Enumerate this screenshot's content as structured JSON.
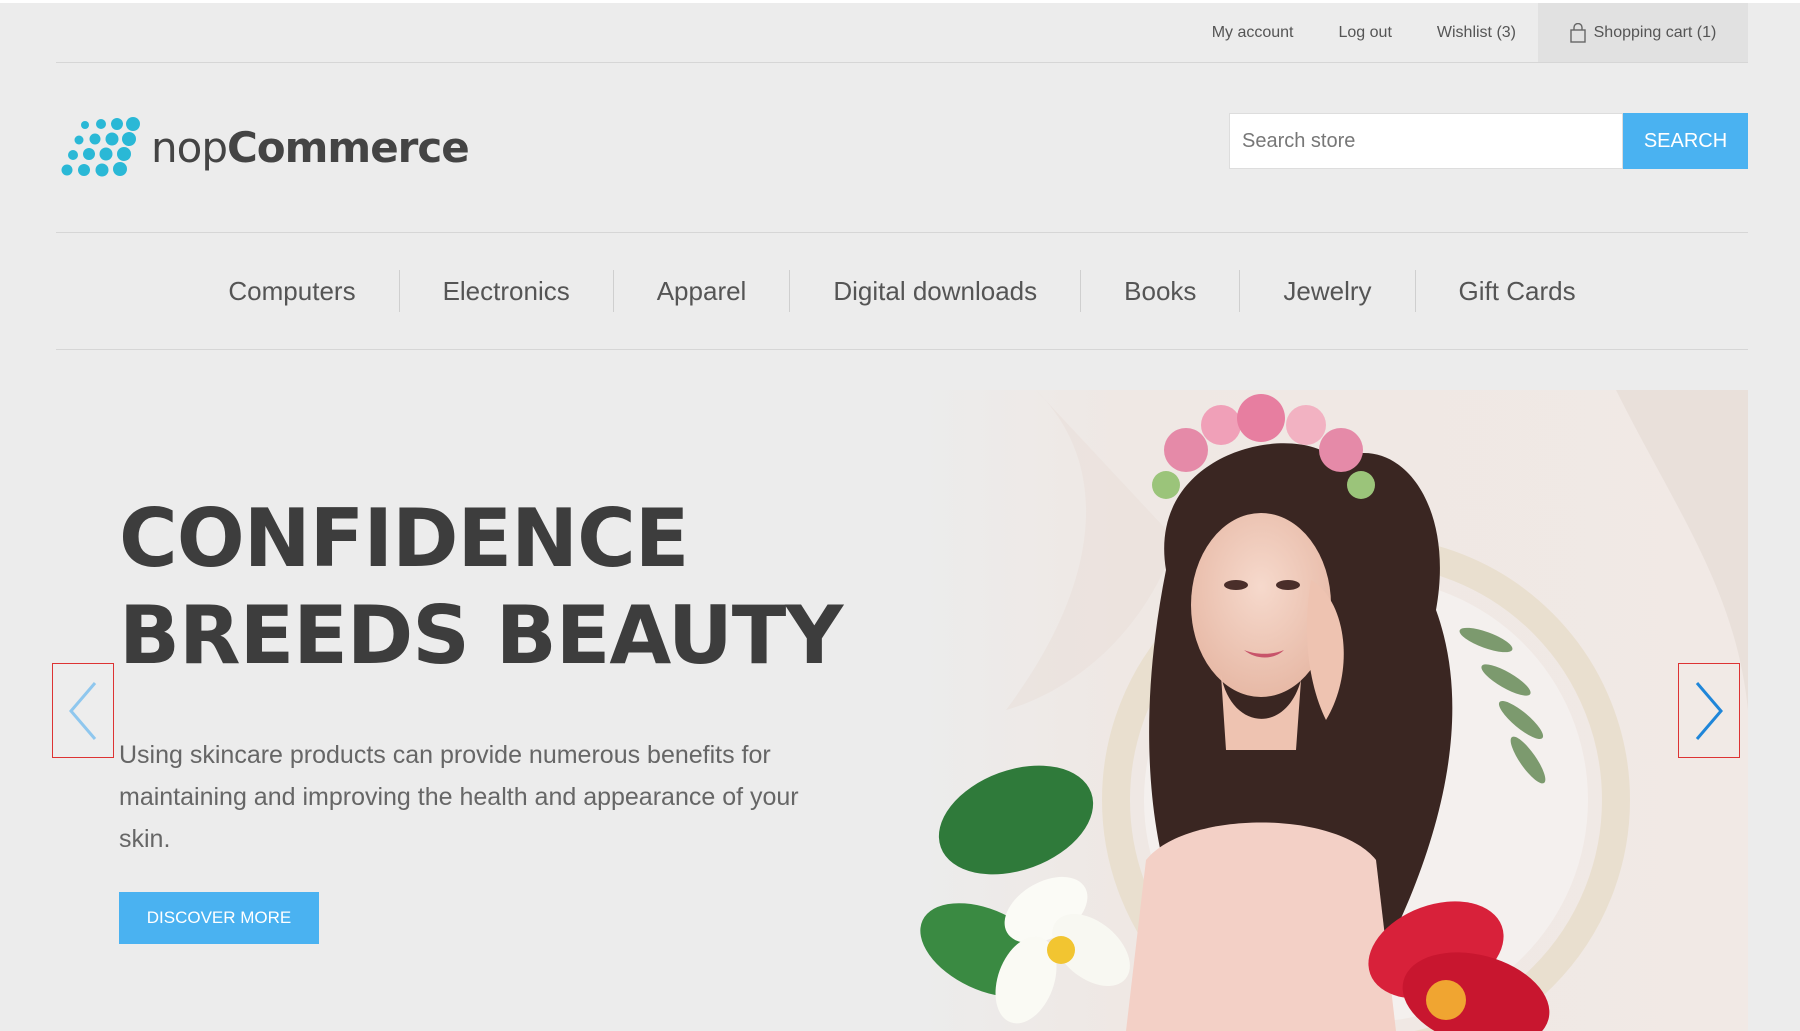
{
  "header": {
    "links": {
      "my_account": "My account",
      "log_out": "Log out",
      "wishlist": "Wishlist (3)",
      "shopping_cart": "Shopping cart (1)"
    },
    "logo": {
      "text_light": "nop",
      "text_bold": "Commerce"
    },
    "search": {
      "placeholder": "Search store",
      "button_label": "SEARCH"
    }
  },
  "menu": {
    "items": [
      "Computers",
      "Electronics",
      "Apparel",
      "Digital downloads",
      "Books",
      "Jewelry",
      "Gift Cards"
    ]
  },
  "slider": {
    "headline_line1": "CONFIDENCE",
    "headline_line2": "BREEDS BEAUTY",
    "description": "Using skincare products can provide numerous benefits for maintaining and improving the health and appearance of your skin.",
    "button_label": "DISCOVER MORE"
  },
  "colors": {
    "accent": "#4ab2f1",
    "logo_dots": "#2ab8d6",
    "arrow_highlight": "#dd3333"
  },
  "icons": {
    "cart": "shopping-bag-icon",
    "prev": "chevron-left-icon",
    "next": "chevron-right-icon"
  }
}
